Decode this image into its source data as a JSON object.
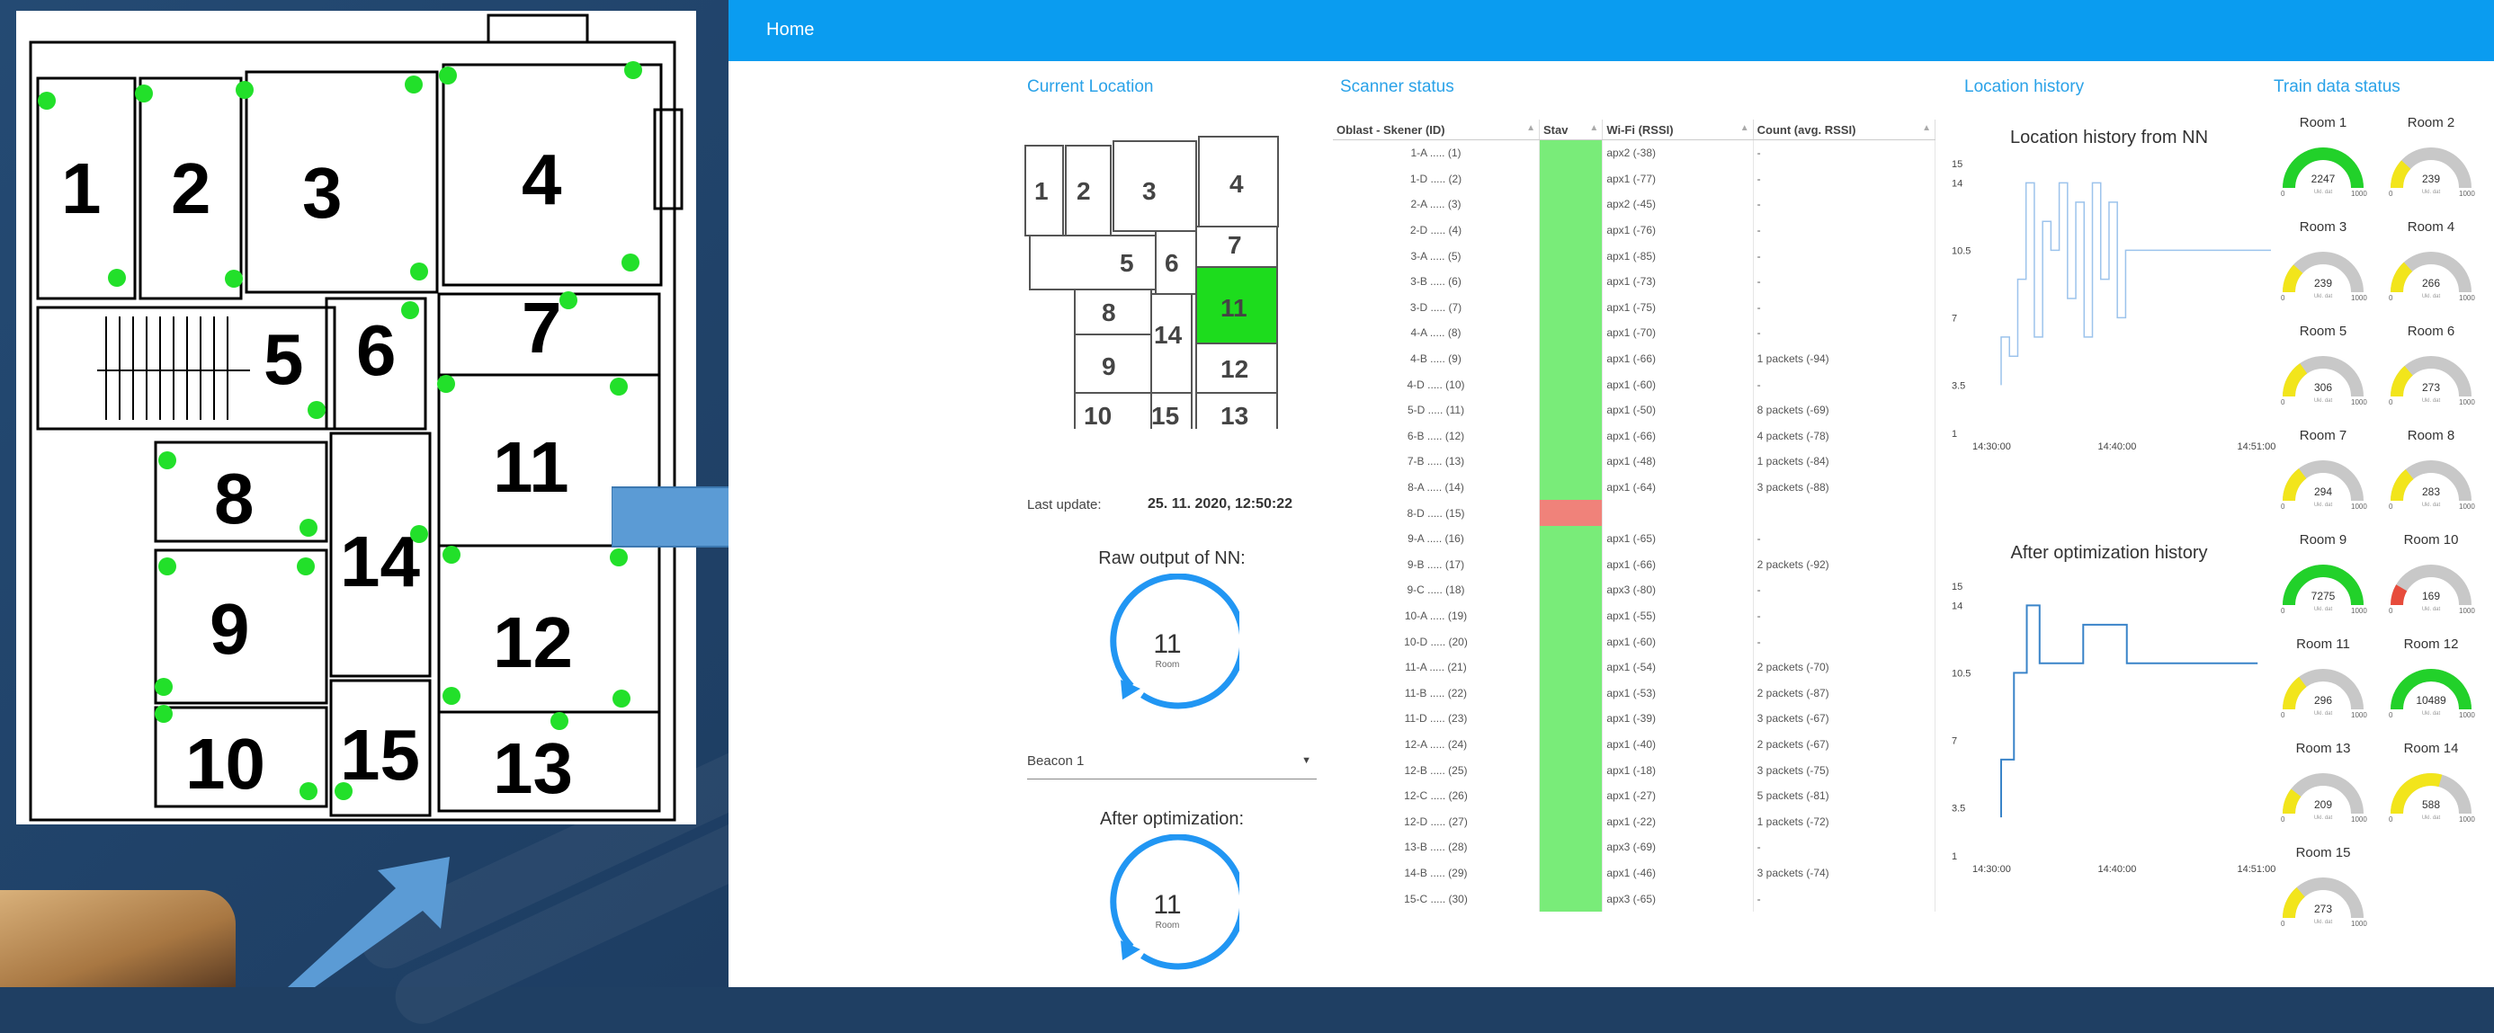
{
  "floor_plan": {
    "rooms": [
      "1",
      "2",
      "3",
      "4",
      "5",
      "6",
      "7",
      "8",
      "9",
      "10",
      "11",
      "12",
      "13",
      "14",
      "15"
    ]
  },
  "colors": {
    "accent": "#0a9cf0",
    "sensor": "#22e02a",
    "active": "#79ec79",
    "inactive": "#f0827a",
    "current_room": "#1ddc1d",
    "arrow": "#5b9bd5"
  },
  "app": {
    "nav": {
      "home_label": "Home"
    },
    "current_location": {
      "title": "Current Location",
      "highlighted_room": "11",
      "last_update_label": "Last update:",
      "last_update_value": "25. 11. 2020, 12:50:22",
      "raw_output_label": "Raw output of NN:",
      "raw_output_value": "11",
      "raw_output_unit": "Room",
      "beacon_select": "Beacon 1",
      "after_opt_label": "After optimization:",
      "after_opt_value": "11",
      "after_opt_unit": "Room"
    },
    "scanner_status": {
      "title": "Scanner status",
      "columns": [
        "Oblast - Skener (ID)",
        "Stav",
        "Wi-Fi (RSSI)",
        "Count (avg. RSSI)"
      ],
      "rows": [
        {
          "id": "1-A ..... (1)",
          "ok": true,
          "wifi": "apx2 (-38)",
          "count": "-"
        },
        {
          "id": "1-D ..... (2)",
          "ok": true,
          "wifi": "apx1 (-77)",
          "count": "-"
        },
        {
          "id": "2-A ..... (3)",
          "ok": true,
          "wifi": "apx2 (-45)",
          "count": "-"
        },
        {
          "id": "2-D ..... (4)",
          "ok": true,
          "wifi": "apx1 (-76)",
          "count": "-"
        },
        {
          "id": "3-A ..... (5)",
          "ok": true,
          "wifi": "apx1 (-85)",
          "count": "-"
        },
        {
          "id": "3-B ..... (6)",
          "ok": true,
          "wifi": "apx1 (-73)",
          "count": "-"
        },
        {
          "id": "3-D ..... (7)",
          "ok": true,
          "wifi": "apx1 (-75)",
          "count": "-"
        },
        {
          "id": "4-A ..... (8)",
          "ok": true,
          "wifi": "apx1 (-70)",
          "count": "-"
        },
        {
          "id": "4-B ..... (9)",
          "ok": true,
          "wifi": "apx1 (-66)",
          "count": "1 packets (-94)"
        },
        {
          "id": "4-D ..... (10)",
          "ok": true,
          "wifi": "apx1 (-60)",
          "count": "-"
        },
        {
          "id": "5-D ..... (11)",
          "ok": true,
          "wifi": "apx1 (-50)",
          "count": "8 packets (-69)"
        },
        {
          "id": "6-B ..... (12)",
          "ok": true,
          "wifi": "apx1 (-66)",
          "count": "4 packets (-78)"
        },
        {
          "id": "7-B ..... (13)",
          "ok": true,
          "wifi": "apx1 (-48)",
          "count": "1 packets (-84)"
        },
        {
          "id": "8-A ..... (14)",
          "ok": true,
          "wifi": "apx1 (-64)",
          "count": "3 packets (-88)"
        },
        {
          "id": "8-D ..... (15)",
          "ok": false,
          "wifi": "",
          "count": ""
        },
        {
          "id": "9-A ..... (16)",
          "ok": true,
          "wifi": "apx1 (-65)",
          "count": "-"
        },
        {
          "id": "9-B ..... (17)",
          "ok": true,
          "wifi": "apx1 (-66)",
          "count": "2 packets (-92)"
        },
        {
          "id": "9-C ..... (18)",
          "ok": true,
          "wifi": "apx3 (-80)",
          "count": "-"
        },
        {
          "id": "10-A ..... (19)",
          "ok": true,
          "wifi": "apx1 (-55)",
          "count": "-"
        },
        {
          "id": "10-D ..... (20)",
          "ok": true,
          "wifi": "apx1 (-60)",
          "count": "-"
        },
        {
          "id": "11-A ..... (21)",
          "ok": true,
          "wifi": "apx1 (-54)",
          "count": "2 packets (-70)"
        },
        {
          "id": "11-B ..... (22)",
          "ok": true,
          "wifi": "apx1 (-53)",
          "count": "2 packets (-87)"
        },
        {
          "id": "11-D ..... (23)",
          "ok": true,
          "wifi": "apx1 (-39)",
          "count": "3 packets (-67)"
        },
        {
          "id": "12-A ..... (24)",
          "ok": true,
          "wifi": "apx1 (-40)",
          "count": "2 packets (-67)"
        },
        {
          "id": "12-B ..... (25)",
          "ok": true,
          "wifi": "apx1 (-18)",
          "count": "3 packets (-75)"
        },
        {
          "id": "12-C ..... (26)",
          "ok": true,
          "wifi": "apx1 (-27)",
          "count": "5 packets (-81)"
        },
        {
          "id": "12-D ..... (27)",
          "ok": true,
          "wifi": "apx1 (-22)",
          "count": "1 packets (-72)"
        },
        {
          "id": "13-B ..... (28)",
          "ok": true,
          "wifi": "apx3 (-69)",
          "count": "-"
        },
        {
          "id": "14-B ..... (29)",
          "ok": true,
          "wifi": "apx1 (-46)",
          "count": "3 packets (-74)"
        },
        {
          "id": "15-C ..... (30)",
          "ok": true,
          "wifi": "apx3 (-65)",
          "count": "-"
        }
      ]
    },
    "location_history": {
      "title": "Location history",
      "chart1_title": "Location history from NN",
      "chart2_title": "After optimization history",
      "y_ticks": [
        "15",
        "14",
        "10.5",
        "7",
        "3.5",
        "1"
      ],
      "x_ticks": [
        "14:30:00",
        "14:40:00",
        "14:51:00"
      ]
    },
    "train_data": {
      "title": "Train data status",
      "min_label": "0",
      "max_label": "1000",
      "unit_label": "Ukl. dat",
      "gauges": [
        {
          "room": "Room 1",
          "value": 2247
        },
        {
          "room": "Room 2",
          "value": 239
        },
        {
          "room": "Room 3",
          "value": 239
        },
        {
          "room": "Room 4",
          "value": 266
        },
        {
          "room": "Room 5",
          "value": 306
        },
        {
          "room": "Room 6",
          "value": 273
        },
        {
          "room": "Room 7",
          "value": 294
        },
        {
          "room": "Room 8",
          "value": 283
        },
        {
          "room": "Room 9",
          "value": 7275
        },
        {
          "room": "Room 10",
          "value": 169
        },
        {
          "room": "Room 11",
          "value": 296
        },
        {
          "room": "Room 12",
          "value": 10489
        },
        {
          "room": "Room 13",
          "value": 209
        },
        {
          "room": "Room 14",
          "value": 588
        },
        {
          "room": "Room 15",
          "value": 273
        }
      ]
    }
  },
  "chart_data": [
    {
      "type": "line",
      "title": "Location history from NN",
      "ylim": [
        1,
        15
      ],
      "x": [
        "14:30:00",
        "14:51:00"
      ],
      "series": [
        {
          "values": [
            3.5,
            6,
            5,
            9,
            14,
            6,
            12,
            10.5,
            14,
            8,
            13,
            6,
            14,
            9,
            13,
            7,
            10.5,
            10.5
          ]
        }
      ]
    },
    {
      "type": "line",
      "title": "After optimization history",
      "ylim": [
        1,
        15
      ],
      "x": [
        "14:30:00",
        "14:51:00"
      ],
      "series": [
        {
          "values": [
            3,
            6,
            10.5,
            14,
            11,
            13,
            11,
            11,
            11
          ]
        }
      ]
    }
  ]
}
